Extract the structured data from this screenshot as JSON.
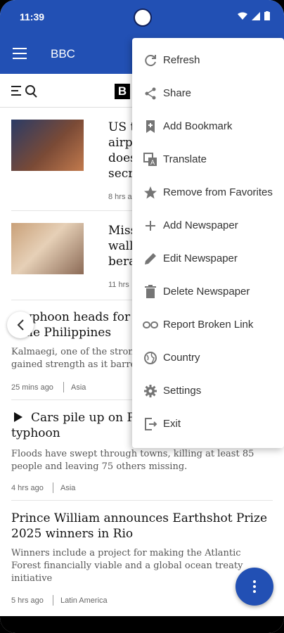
{
  "status_bar": {
    "time": "11:39"
  },
  "app_bar": {
    "title": "BBC"
  },
  "brand": {
    "logo_letter": "B"
  },
  "articles": [
    {
      "headline_line1": "US t",
      "headline_line2": "airp",
      "headline_line3": "does",
      "headline_line4": "secr",
      "meta": "8 hrs a"
    },
    {
      "headline_line1": "Miss",
      "headline_line2": "wall",
      "headline_line3": "bera",
      "meta": "11 hrs"
    },
    {
      "headline_line1": "yphoon heads for V",
      "headline_line2": "he Philippines",
      "summary_line1": "Kalmaegi, one of the stron",
      "summary_line2": "gained strength as it barre",
      "time": "25 mins ago",
      "region": "Asia"
    },
    {
      "headline_line1": "Cars pile up on Ph",
      "headline_line2": "typhoon",
      "summary_line1": "Floods have swept through towns, killing at least 85",
      "summary_line2": "people and leaving 75 others missing.",
      "time": "4 hrs ago",
      "region": "Asia"
    },
    {
      "headline_line1": "Prince William announces Earthshot Prize",
      "headline_line2": "2025 winners in Rio",
      "summary_line1": "Winners include a project for making the Atlantic",
      "summary_line2": "Forest financially viable and a global ocean treaty",
      "summary_line3": "initiative",
      "time": "5 hrs ago",
      "region": "Latin America"
    }
  ],
  "menu": {
    "items": [
      {
        "label": "Refresh",
        "icon": "refresh-icon"
      },
      {
        "label": "Share",
        "icon": "share-icon"
      },
      {
        "label": "Add Bookmark",
        "icon": "bookmark-add-icon"
      },
      {
        "label": "Translate",
        "icon": "translate-icon"
      },
      {
        "label": "Remove from Favorites",
        "icon": "star-icon"
      },
      {
        "label": "Add Newspaper",
        "icon": "plus-icon"
      },
      {
        "label": "Edit Newspaper",
        "icon": "pencil-icon"
      },
      {
        "label": "Delete Newspaper",
        "icon": "trash-icon"
      },
      {
        "label": "Report Broken Link",
        "icon": "broken-link-icon"
      },
      {
        "label": "Country",
        "icon": "globe-icon"
      },
      {
        "label": "Settings",
        "icon": "gear-icon"
      },
      {
        "label": "Exit",
        "icon": "exit-icon"
      }
    ]
  },
  "colors": {
    "primary": "#2250b4",
    "menu_icon": "#757575"
  }
}
